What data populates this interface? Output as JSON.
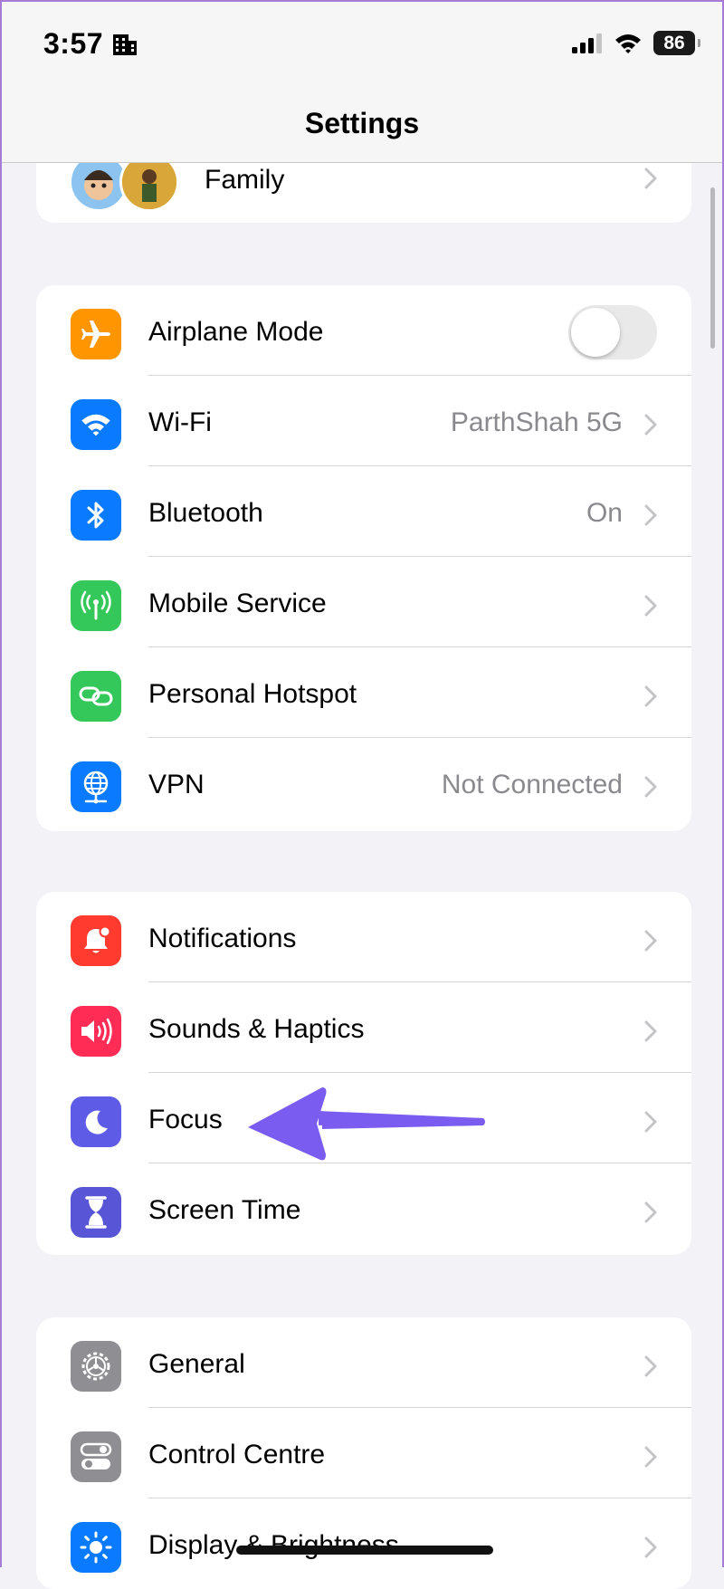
{
  "status_bar": {
    "time": "3:57",
    "battery": "86"
  },
  "header": {
    "title": "Settings"
  },
  "family": {
    "label": "Family"
  },
  "connectivity": [
    {
      "label": "Airplane Mode",
      "toggle": false
    },
    {
      "label": "Wi-Fi",
      "value": "ParthShah 5G"
    },
    {
      "label": "Bluetooth",
      "value": "On"
    },
    {
      "label": "Mobile Service"
    },
    {
      "label": "Personal Hotspot"
    },
    {
      "label": "VPN",
      "value": "Not Connected"
    }
  ],
  "attention": [
    {
      "label": "Notifications"
    },
    {
      "label": "Sounds & Haptics"
    },
    {
      "label": "Focus"
    },
    {
      "label": "Screen Time"
    }
  ],
  "system": [
    {
      "label": "General"
    },
    {
      "label": "Control Centre"
    },
    {
      "label": "Display & Brightness"
    }
  ],
  "colors": {
    "airplane": "#ff9500",
    "wifi": "#0a7aff",
    "bluetooth": "#0a7aff",
    "mobile": "#34c759",
    "hotspot": "#34c759",
    "vpn": "#0a7aff",
    "notifications": "#ff3b30",
    "sounds": "#ff2d55",
    "focus": "#5e5ce6",
    "screen_time": "#5856d6",
    "general": "#8e8e93",
    "control": "#8e8e93",
    "display": "#0a7aff",
    "annotation_arrow": "#7b5cf0"
  },
  "icons": [
    "airplane-icon",
    "wifi-icon",
    "bluetooth-icon",
    "antenna-icon",
    "link-icon",
    "globe-icon",
    "bell-icon",
    "speaker-icon",
    "moon-icon",
    "hourglass-icon",
    "gear-icon",
    "toggles-icon",
    "sun-icon"
  ]
}
